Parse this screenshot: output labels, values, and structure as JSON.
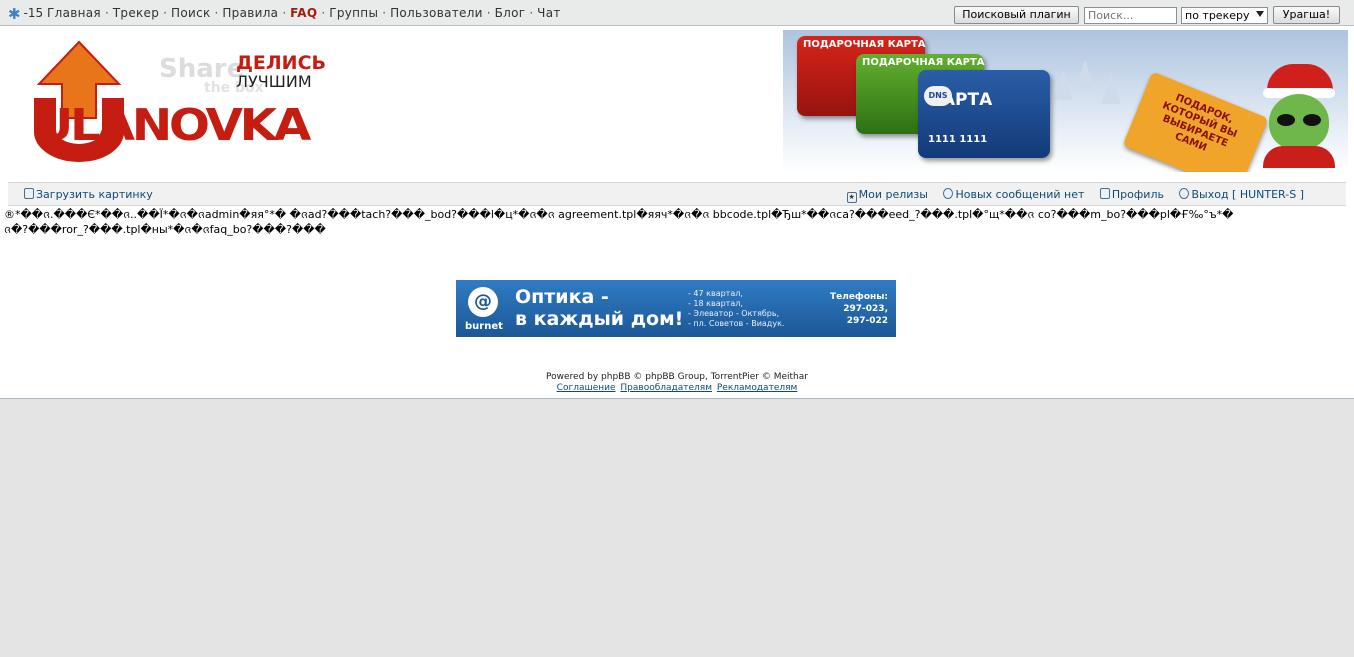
{
  "topbar": {
    "temperature": "-15",
    "nav": [
      "Главная",
      "Трекер",
      "Поиск",
      "Правила",
      "FAQ",
      "Группы",
      "Пользователи",
      "Блог",
      "Чат"
    ],
    "plugin_button": "Поисковый плагин",
    "search_placeholder": "Поиск...",
    "tracker_select": "по трекеру",
    "go_button": "Урагша!"
  },
  "logo": {
    "word": "ULANOVKA",
    "share": "Share",
    "the_box": "the box",
    "tagline_top": "ДЕЛИСЬ",
    "tagline_bottom": "ЛУЧШИМ"
  },
  "banner": {
    "card1": "ПОДАРОЧНАЯ КАРТА",
    "card2": "ПОДАРОЧНАЯ КАРТА",
    "card3": "КАРТА",
    "card3_brand": "DNS",
    "card_number": "1111 1111",
    "tag_text": "ПОДАРОК, КОТОРЫЙ ВЫ ВЫБИРАЕТЕ САМИ"
  },
  "subbar": {
    "upload": "Загрузить картинку",
    "my_releases": "Мои релизы",
    "no_new_messages": "Новых сообщений нет",
    "profile": "Профиль",
    "logout": "Выход [ HUNTER-S ]"
  },
  "garbage_text": "®*��ᨩ.���Є*��ᨩ..��Ї*�ᨩ�ᨩadmin�яя°*� �ᨩad?���tach?���_bod?���l�ц*�ᨩ�ᨩ agreement.tpl�яяч*�ᨩ�ᨩ bbcode.tpl�Ђш*��ᨩca?���eed_?���.tpl�°щ*��ᨩ co?���m_bo?���pl�Ғ‰°ъ*�ᨩ�?���ror_?���.tpl�ны*�ᨩ�ᨩfaq_bo?���?���",
  "ad": {
    "brand": "burnet",
    "headline1": "Оптика -",
    "headline2": "в каждый дом!",
    "lines": [
      "- 47 квартал,",
      "- 18 квартал,",
      "- Элеватор - Октябрь,",
      "- пл. Советов - Виадук."
    ],
    "phones_label": "Телефоны:",
    "phone1": "297-023,",
    "phone2": "297-022"
  },
  "footer": {
    "powered": "Powered by phpBB © phpBB Group, TorrentPier © Meithar",
    "links": [
      "Соглашение",
      "Правообладателям",
      "Рекламодателям"
    ]
  },
  "colors": {
    "brand_red": "#c51d12",
    "link": "#0b4c7a",
    "faq": "#a01e0c"
  }
}
